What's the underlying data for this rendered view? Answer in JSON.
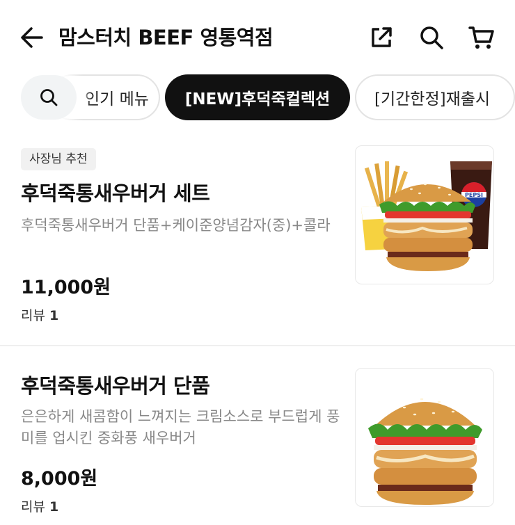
{
  "header": {
    "title": "맘스터치 BEEF 영통역점",
    "back_icon": "arrow-left-icon",
    "share_icon": "share-icon",
    "search_icon": "search-icon",
    "cart_icon": "cart-icon"
  },
  "tabs": {
    "search_icon": "search-icon",
    "items": [
      {
        "label": "인기 메뉴",
        "visible_text": "인기 메뉴",
        "active": false
      },
      {
        "label": "[NEW]후덕죽컬렉션",
        "active": true
      },
      {
        "label": "[기간한정]재출시",
        "active": false
      }
    ]
  },
  "menu": [
    {
      "badge": "사장님 추천",
      "name": "후덕죽통새우버거 세트",
      "description": "후덕죽통새우버거 단품+케이준양념감자(중)+콜라",
      "price": "11,000원",
      "review_label": "리뷰",
      "review_count": "1",
      "image": "burger-set-image",
      "image_text": "PEPSI"
    },
    {
      "name": "후덕죽통새우버거 단품",
      "description": "은은하게 새콤함이 느껴지는 크림소스로 부드럽게 풍미를 업시킨 중화풍 새우버거",
      "price": "8,000원",
      "review_label": "리뷰",
      "review_count": "1",
      "image": "burger-single-image"
    }
  ],
  "colors": {
    "active_tab_bg": "#111111",
    "tab_border": "#e3e3e3",
    "badge_bg": "#f1f1f1",
    "desc_text": "#888888"
  }
}
